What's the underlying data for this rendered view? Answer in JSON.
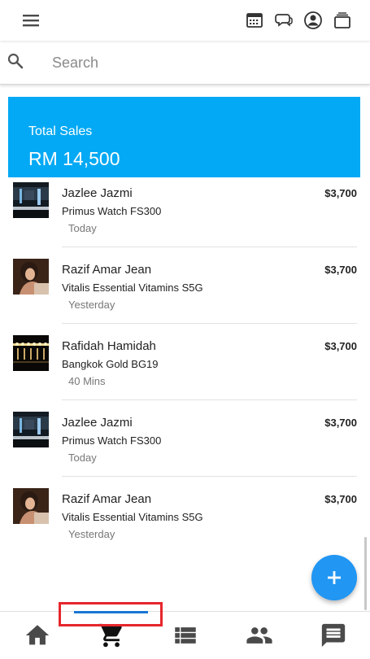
{
  "search": {
    "placeholder": "Search"
  },
  "sales": {
    "label": "Total Sales",
    "value": "RM 14,500"
  },
  "transactions": [
    {
      "name": "Jazlee Jazmi",
      "product": "Primus Watch FS300",
      "time": "Today",
      "price": "$3,700",
      "thumb": "stage-photo"
    },
    {
      "name": "Razif Amar Jean",
      "product": "Vitalis Essential Vitamins S5G",
      "time": "Yesterday",
      "price": "$3,700",
      "thumb": "portrait-photo"
    },
    {
      "name": "Rafidah Hamidah",
      "product": "Bangkok Gold BG19",
      "time": "40 Mins",
      "price": "$3,700",
      "thumb": "runway-photo"
    },
    {
      "name": "Jazlee Jazmi",
      "product": "Primus Watch FS300",
      "time": "Today",
      "price": "$3,700",
      "thumb": "stage-photo"
    },
    {
      "name": "Razif Amar Jean",
      "product": "Vitalis Essential Vitamins S5G",
      "time": "Yesterday",
      "price": "$3,700",
      "thumb": "portrait-photo"
    }
  ],
  "icons": {
    "top_bar": [
      "menu-icon",
      "calendar-icon",
      "chat-icon",
      "account-icon",
      "cards-icon"
    ],
    "search": "search-icon",
    "fab": "plus-icon",
    "bottom_nav": [
      "home-icon",
      "cart-icon",
      "list-icon",
      "people-icon",
      "message-icon"
    ]
  },
  "navigation": {
    "active_tab": "cart"
  },
  "colors": {
    "accent": "#03a9f4",
    "fab": "#2196f3",
    "nav_indicator": "#1976d2",
    "highlight": "#e6262c",
    "icon": "#4a4a4a"
  }
}
